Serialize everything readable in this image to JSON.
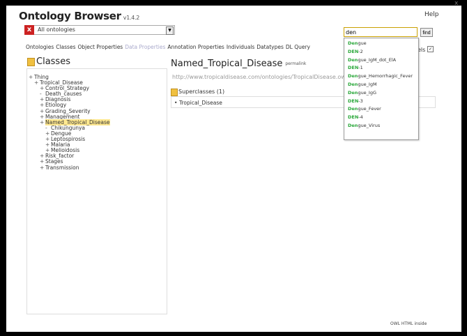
{
  "app": {
    "title": "Ontology Browser",
    "version": "v1.4.2",
    "help": "Help",
    "close": "x"
  },
  "ontology_select": {
    "value": "All ontologies",
    "close_icon": "x"
  },
  "search": {
    "value": "den",
    "find_label": "find"
  },
  "tabs": [
    {
      "label": "Ontologies",
      "enabled": true
    },
    {
      "label": "Classes",
      "enabled": true
    },
    {
      "label": "Object Properties",
      "enabled": true
    },
    {
      "label": "Data Properties",
      "enabled": false
    },
    {
      "label": "Annotation Properties",
      "enabled": true
    },
    {
      "label": "Individuals",
      "enabled": true
    },
    {
      "label": "Datatypes",
      "enabled": true
    },
    {
      "label": "DL Query",
      "enabled": true
    }
  ],
  "labels_toggle": {
    "label": "els",
    "checked": true
  },
  "classes_panel": {
    "heading": "Classes",
    "tree": [
      {
        "label": "Thing",
        "prefix": "+",
        "depth": 0,
        "selected": false
      },
      {
        "label": "Tropical_Disease",
        "prefix": "+",
        "depth": 1,
        "selected": false
      },
      {
        "label": "Control_Strategy",
        "prefix": "+",
        "depth": 2,
        "selected": false
      },
      {
        "label": "Death_causes",
        "prefix": "-",
        "depth": 2,
        "selected": false
      },
      {
        "label": "Diagnosis",
        "prefix": "+",
        "depth": 2,
        "selected": false
      },
      {
        "label": "Etiology",
        "prefix": "+",
        "depth": 2,
        "selected": false
      },
      {
        "label": "Grading_Severity",
        "prefix": "+",
        "depth": 2,
        "selected": false
      },
      {
        "label": "Management",
        "prefix": "+",
        "depth": 2,
        "selected": false
      },
      {
        "label": "Named_Tropical_Disease",
        "prefix": "+",
        "depth": 2,
        "selected": true
      },
      {
        "label": "Chikungunya",
        "prefix": "-",
        "depth": 3,
        "selected": false
      },
      {
        "label": "Dengue",
        "prefix": "+",
        "depth": 3,
        "selected": false
      },
      {
        "label": "Leptospirosis",
        "prefix": "+",
        "depth": 3,
        "selected": false
      },
      {
        "label": "Malaria",
        "prefix": "+",
        "depth": 3,
        "selected": false
      },
      {
        "label": "Melioidosis",
        "prefix": "+",
        "depth": 3,
        "selected": false
      },
      {
        "label": "Risk_factor",
        "prefix": "+",
        "depth": 2,
        "selected": false
      },
      {
        "label": "Stages",
        "prefix": "+",
        "depth": 2,
        "selected": false
      },
      {
        "label": "Transmission",
        "prefix": "+",
        "depth": 2,
        "selected": false
      }
    ]
  },
  "entity": {
    "title": "Named_Tropical_Disease",
    "permalink": "permalink",
    "uri": "http://www.tropicaldisease.com/ontologies/TropicalDisease.owl#Named",
    "superclasses_label": "Superclasses (1)",
    "superclasses": [
      {
        "label": "Tropical_Disease",
        "prefix": "•"
      }
    ]
  },
  "search_results": [
    {
      "match": "Den",
      "rest": "gue"
    },
    {
      "match": "DEN",
      "rest": "-2"
    },
    {
      "match": "Den",
      "rest": "gue_IgM_dot_ElA"
    },
    {
      "match": "DEN",
      "rest": "-1"
    },
    {
      "match": "Den",
      "rest": "gue_Hemorrhagic_Fever"
    },
    {
      "match": "Den",
      "rest": "gue_IgM"
    },
    {
      "match": "Den",
      "rest": "gue_IgG"
    },
    {
      "match": "DEN",
      "rest": "-3"
    },
    {
      "match": "Den",
      "rest": "gue_Fever"
    },
    {
      "match": "DEN",
      "rest": "-4"
    },
    {
      "match": "Den",
      "rest": "gue_Virus"
    }
  ],
  "footer": {
    "text": "OWL HTML inside"
  },
  "colors": {
    "match_highlight": "#2aa83a",
    "selected_node": "#ffe890",
    "folder_icon": "#f0c040",
    "close_red": "#cc2222"
  }
}
